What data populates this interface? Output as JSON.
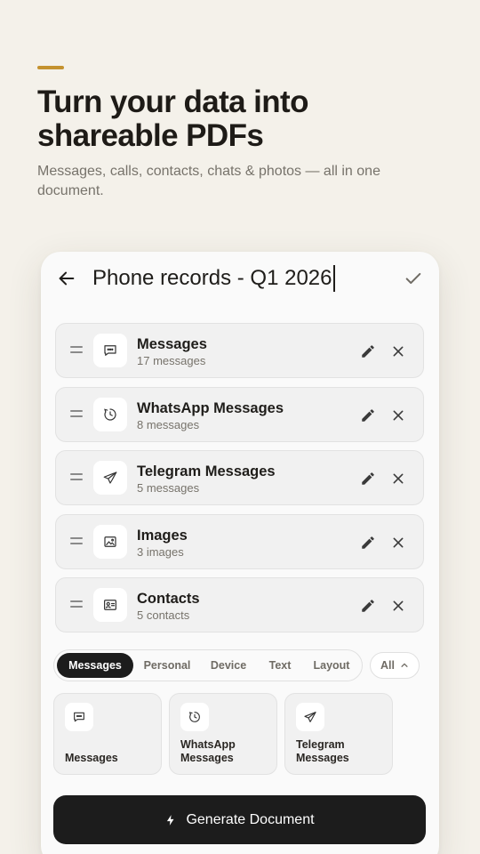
{
  "hero": {
    "title": "Turn your data into shareable PDFs",
    "subtitle": "Messages, calls, contacts, chats & photos — all in one document."
  },
  "editor": {
    "document_title": "Phone records - Q1 2026",
    "items": [
      {
        "title": "Messages",
        "subtitle": "17 messages",
        "icon": "chat-bubble-icon"
      },
      {
        "title": "WhatsApp Messages",
        "subtitle": "8 messages",
        "icon": "whatsapp-icon"
      },
      {
        "title": "Telegram Messages",
        "subtitle": "5 messages",
        "icon": "telegram-icon"
      },
      {
        "title": "Images",
        "subtitle": "3 images",
        "icon": "image-icon"
      },
      {
        "title": "Contacts",
        "subtitle": "5 contacts",
        "icon": "contact-card-icon"
      }
    ]
  },
  "categories": {
    "tabs": [
      {
        "label": "Messages",
        "active": true
      },
      {
        "label": "Personal",
        "active": false
      },
      {
        "label": "Device",
        "active": false
      },
      {
        "label": "Text",
        "active": false
      },
      {
        "label": "Layout",
        "active": false
      }
    ],
    "filter_label": "All"
  },
  "tiles": [
    {
      "label": "Messages",
      "icon": "chat-bubble-icon"
    },
    {
      "label": "WhatsApp Messages",
      "icon": "whatsapp-icon"
    },
    {
      "label": "Telegram Messages",
      "icon": "telegram-icon"
    }
  ],
  "actions": {
    "generate_label": "Generate Document"
  },
  "colors": {
    "background": "#f4f1ea",
    "accent": "#c4922f",
    "primary_dark": "#1c1c1c"
  }
}
